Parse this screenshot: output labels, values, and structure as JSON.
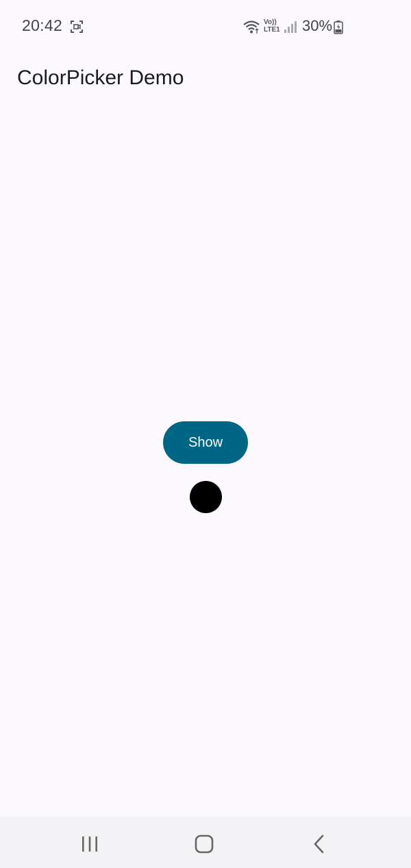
{
  "status_bar": {
    "time": "20:42",
    "volte_top": "Vo))",
    "volte_bottom": "LTE1",
    "battery_percent": "30%",
    "icons": [
      "screen-record-icon",
      "wifi-icon",
      "volte-icon",
      "signal-icon",
      "battery-charging-icon"
    ]
  },
  "app": {
    "title": "ColorPicker Demo"
  },
  "main": {
    "show_button_label": "Show",
    "selected_color": "#000000",
    "button_color": "#006686"
  },
  "nav_bar": {
    "icons": [
      "recents-icon",
      "home-icon",
      "back-icon"
    ]
  }
}
